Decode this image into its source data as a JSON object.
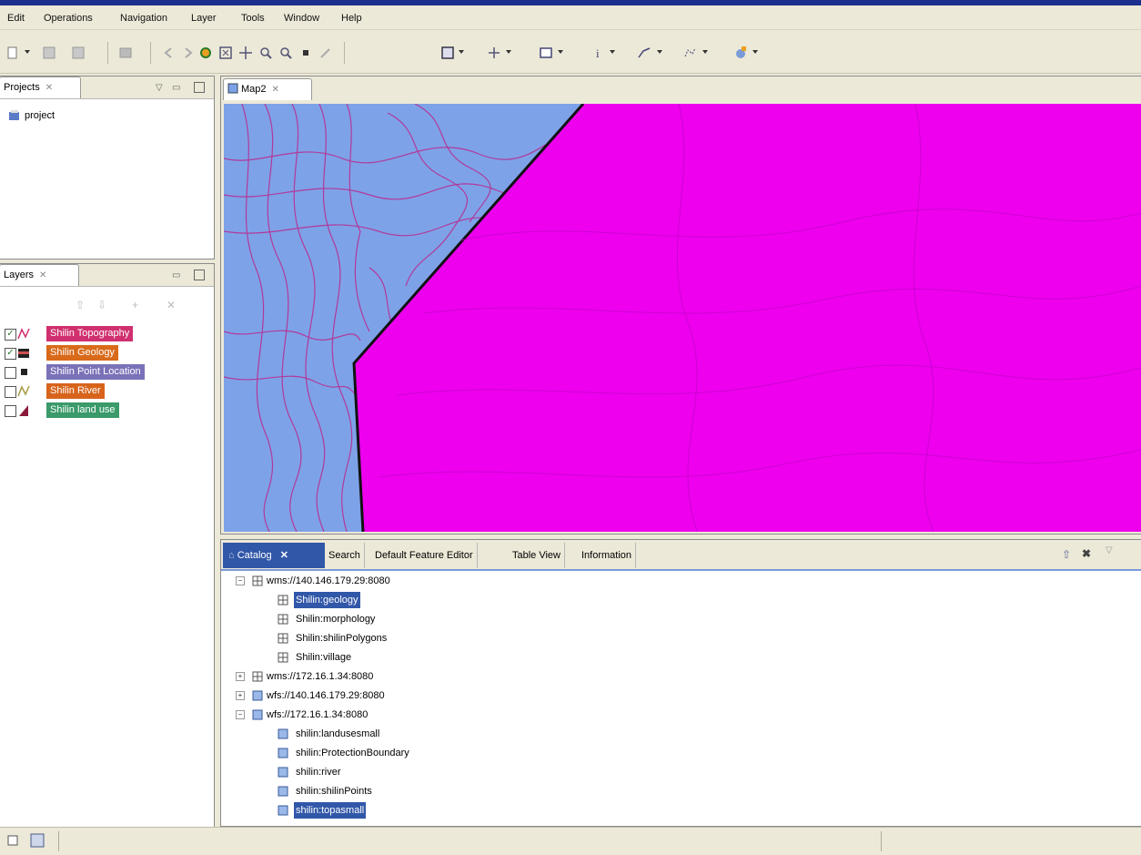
{
  "menu": [
    "Edit",
    "Operations",
    "Navigation",
    "Layer",
    "Tools",
    "Window",
    "Help"
  ],
  "projects": {
    "tab": "Projects",
    "items": [
      "project"
    ]
  },
  "layers": {
    "tab": "Layers",
    "items": [
      {
        "label": "Shilin Topography",
        "checked": true,
        "color": "#d0306f"
      },
      {
        "label": "Shilin Geology",
        "checked": true,
        "color": "#d86a1a"
      },
      {
        "label": "Shilin Point Location",
        "checked": false,
        "color": "#7a72b8"
      },
      {
        "label": "Shilin River",
        "checked": false,
        "color": "#d8641c"
      },
      {
        "label": "Shilin land use",
        "checked": false,
        "color": "#3a9a6a"
      }
    ]
  },
  "map": {
    "tab": "Map2",
    "colors": {
      "water": "#7ea2e8",
      "polygon": "#ee00ee",
      "contour": "#b03a9a"
    }
  },
  "bottom_tabs": [
    "Catalog",
    "Search",
    "Default Feature Editor",
    "Table View",
    "Information"
  ],
  "catalog": {
    "nodes": [
      {
        "label": "wms://140.146.179.29:8080",
        "level": 0,
        "expanded": true,
        "icon": "wms-icon"
      },
      {
        "label": "Shilin:geology",
        "level": 1,
        "selected": true,
        "icon": "layer-icon"
      },
      {
        "label": "Shilin:morphology",
        "level": 1,
        "icon": "layer-icon"
      },
      {
        "label": "Shilin:shilinPolygons",
        "level": 1,
        "icon": "layer-icon"
      },
      {
        "label": "Shilin:village",
        "level": 1,
        "icon": "layer-icon"
      },
      {
        "label": "wms://172.16.1.34:8080",
        "level": 0,
        "expanded": false,
        "icon": "wms-icon"
      },
      {
        "label": "wfs://140.146.179.29:8080",
        "level": 0,
        "expanded": false,
        "icon": "wfs-icon"
      },
      {
        "label": "wfs://172.16.1.34:8080",
        "level": 0,
        "expanded": true,
        "icon": "wfs-icon"
      },
      {
        "label": "shilin:landusesmall",
        "level": 1,
        "icon": "feature-icon"
      },
      {
        "label": "shilin:ProtectionBoundary",
        "level": 1,
        "icon": "feature-icon"
      },
      {
        "label": "shilin:river",
        "level": 1,
        "icon": "feature-icon"
      },
      {
        "label": "shilin:shilinPoints",
        "level": 1,
        "icon": "feature-icon"
      },
      {
        "label": "shilin:topasmall",
        "level": 1,
        "selected": true,
        "icon": "feature-icon"
      }
    ]
  }
}
